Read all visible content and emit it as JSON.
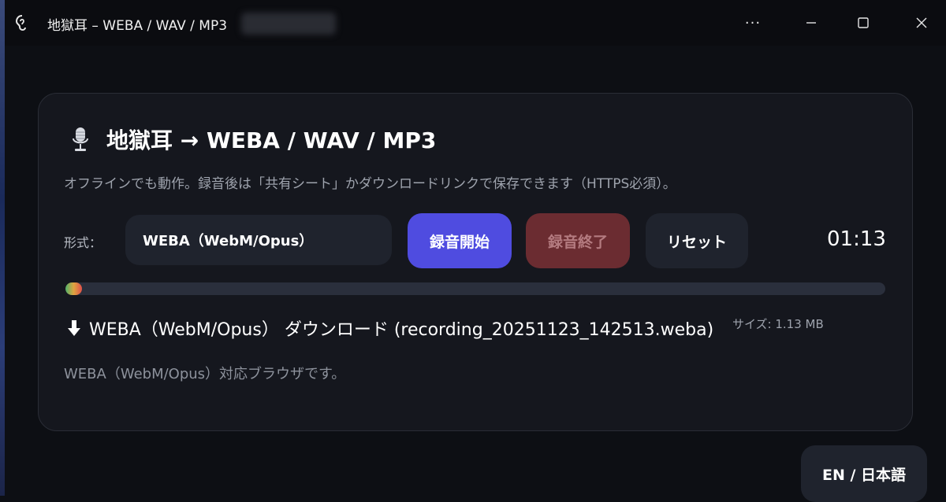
{
  "window": {
    "title": "地獄耳 – WEBA / WAV / MP3",
    "controls": {
      "more": "···",
      "minimize_icon": "minimize-icon",
      "maximize_icon": "maximize-icon",
      "close_icon": "close-icon"
    }
  },
  "card": {
    "title": "地獄耳 → WEBA / WAV / MP3",
    "title_icon": "microphone-icon",
    "subtitle": "オフラインでも動作。録音後は「共有シート」かダウンロードリンクで保存できます（HTTPS必須）。"
  },
  "controls": {
    "format_label": "形式：",
    "format_value": "WEBA（WebM/Opus）",
    "start_label": "録音開始",
    "stop_label": "録音終了",
    "reset_label": "リセット",
    "timer": "01:13"
  },
  "progress": {
    "level": 0.02
  },
  "download": {
    "icon": "download-arrow-icon",
    "link_text": "WEBA（WebM/Opus） ダウンロード (recording_20251123_142513.weba)",
    "size": "サイズ: 1.13 MB"
  },
  "support_text": "WEBA（WebM/Opus）対応ブラウザです。",
  "language_toggle": "EN / 日本語",
  "colors": {
    "accent": "#4f4ce0",
    "stop": "#6b2c31",
    "card_bg": "#15171e",
    "page_bg": "#0d0f14"
  }
}
